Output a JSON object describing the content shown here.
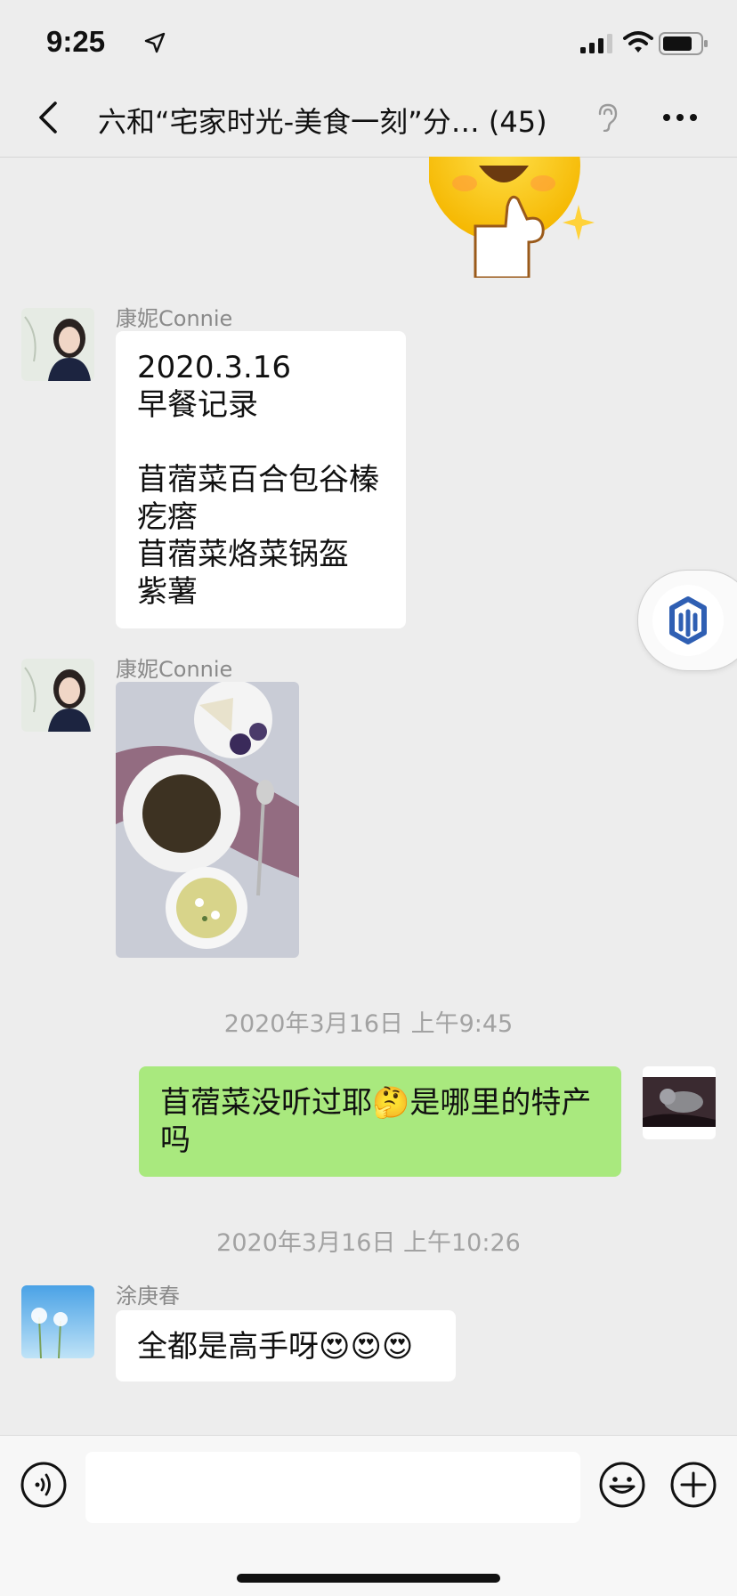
{
  "status": {
    "time": "9:25"
  },
  "header": {
    "title": "六和“宅家时光-美食一刻”分… (45)"
  },
  "messages": [
    {
      "sender": "康妮Connie",
      "lines": [
        "2020.3.16",
        "早餐记录",
        "",
        "苜蓿菜百合包谷榛",
        "疙瘩",
        "苜蓿菜烙菜锅盔",
        "紫薯"
      ]
    },
    {
      "sender": "康妮Connie"
    },
    {
      "timestamp": "2020年3月16日 上午9:45"
    },
    {
      "lines": [
        "苜蓿菜没听过耶🤔是哪里的特产",
        "吗"
      ]
    },
    {
      "timestamp": "2020年3月16日 上午10:26"
    },
    {
      "sender": "涂庚春",
      "text": "全都是高手呀😍😍😍"
    }
  ],
  "colors": {
    "background": "#ededed",
    "bubble_self": "#a9e97e",
    "bubble_other": "#ffffff",
    "accent_blue": "#2f5fb3"
  },
  "icons": [
    "location-arrow-icon",
    "signal-icon",
    "wifi-icon",
    "battery-icon",
    "back-icon",
    "ear-icon",
    "more-icon",
    "voice-icon",
    "emoji-icon",
    "plus-icon",
    "floating-logo-icon"
  ]
}
